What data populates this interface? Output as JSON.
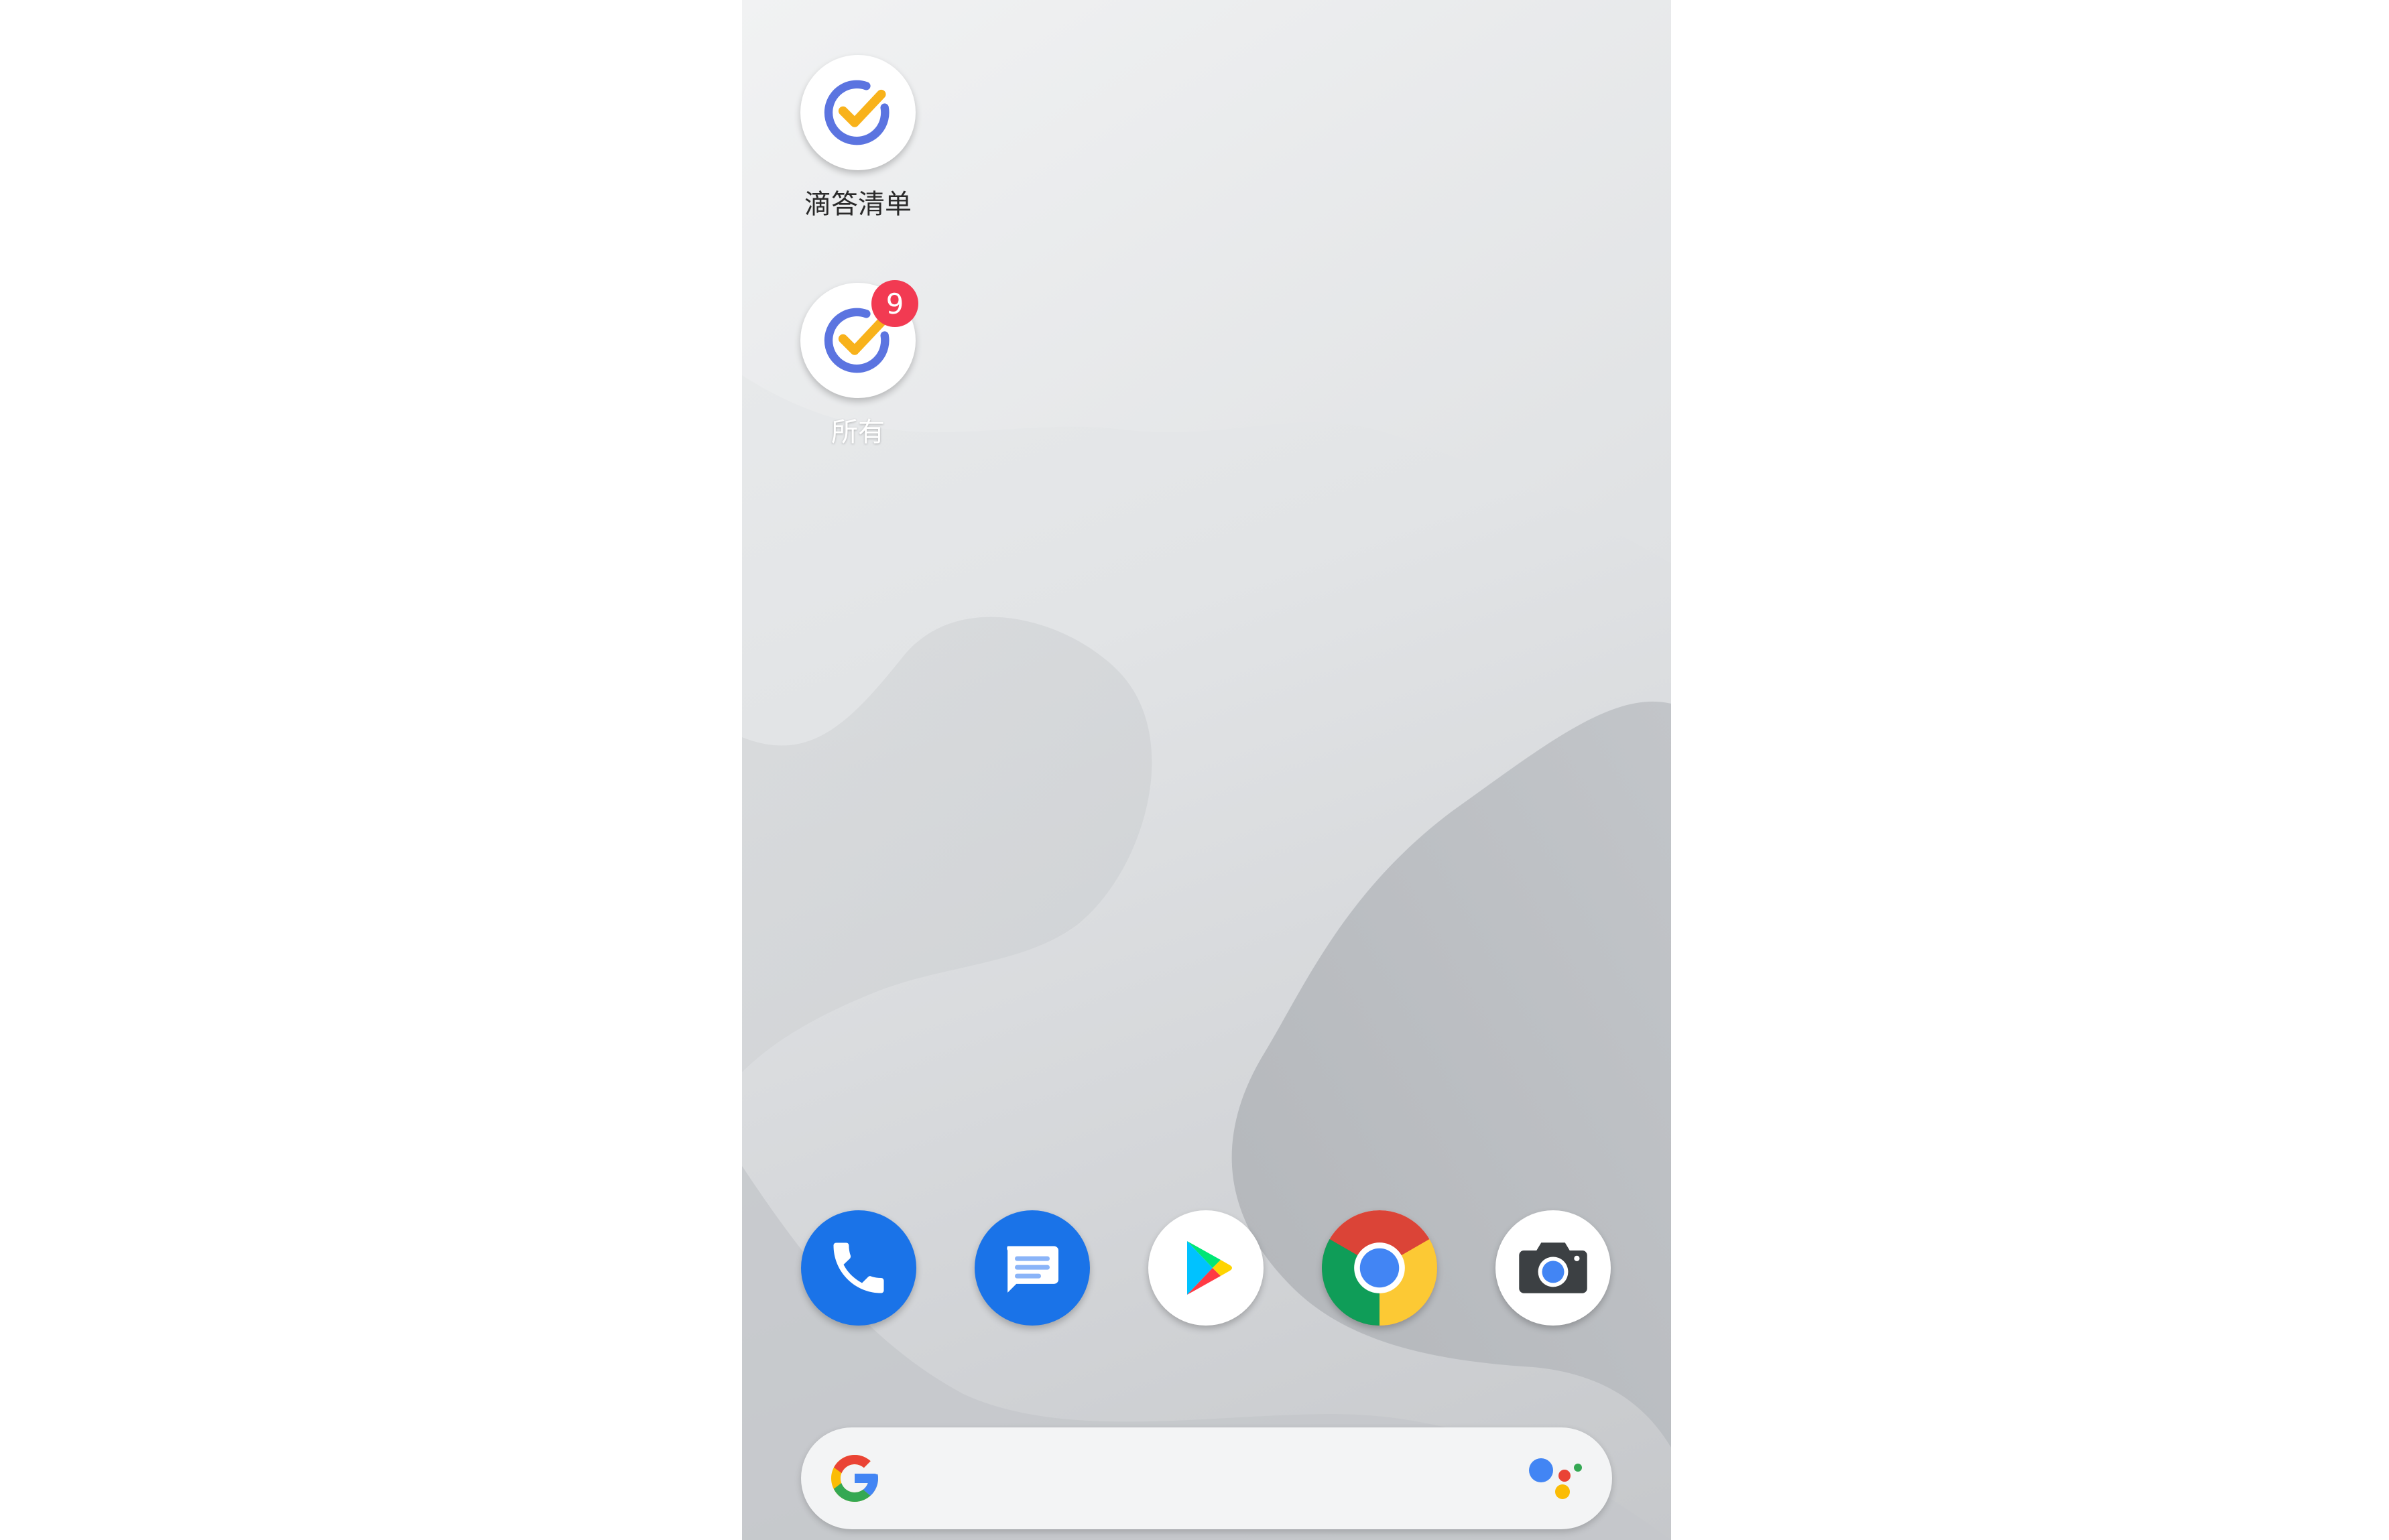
{
  "home_screen": {
    "shortcuts": [
      {
        "label": "滴答清单",
        "icon": "ticktick-icon"
      },
      {
        "label": "所有",
        "icon": "ticktick-icon",
        "badge": "9"
      }
    ],
    "dock": [
      {
        "name": "phone",
        "icon": "phone-icon",
        "color": "#1a73e8"
      },
      {
        "name": "messages",
        "icon": "messages-icon",
        "color": "#1a73e8"
      },
      {
        "name": "play-store",
        "icon": "play-store-icon"
      },
      {
        "name": "chrome",
        "icon": "chrome-icon"
      },
      {
        "name": "camera",
        "icon": "camera-icon"
      }
    ],
    "search": {
      "logo": "google-g-icon",
      "assistant": "google-assistant-icon"
    }
  },
  "colors": {
    "ticktick_blue": "#5b74e0",
    "ticktick_yellow": "#f8b21b",
    "badge_red": "#f23a52"
  }
}
